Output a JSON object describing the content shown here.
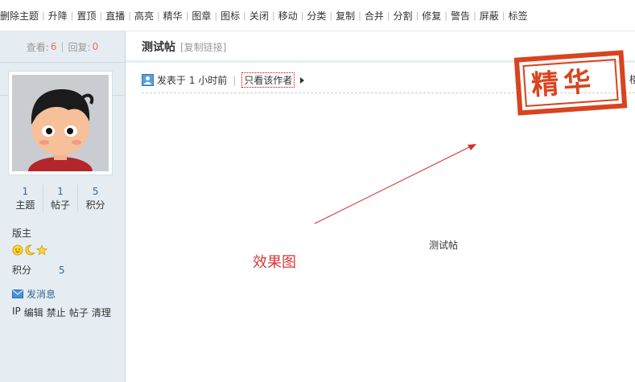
{
  "toolbar": {
    "items": [
      "删除主题",
      "升降",
      "置顶",
      "直播",
      "高亮",
      "精华",
      "图章",
      "图标",
      "关闭",
      "移动",
      "分类",
      "复制",
      "合并",
      "分割",
      "修复",
      "警告",
      "屏蔽",
      "标签"
    ]
  },
  "sidebar": {
    "views_label": "查看:",
    "views": "6",
    "replies_label": "回复:",
    "replies": "0",
    "author": "版主",
    "counters": [
      {
        "value": "1",
        "label": "主题"
      },
      {
        "value": "1",
        "label": "帖子"
      },
      {
        "value": "5",
        "label": "积分"
      }
    ],
    "group": "版主",
    "points_label": "积分",
    "points_value": "5",
    "send_message": "发消息",
    "admin_links": [
      "IP",
      "编辑",
      "禁止",
      "帖子",
      "清理"
    ]
  },
  "post": {
    "title": "测试帖",
    "copy_link": "[复制链接]",
    "posted_time": "发表于 1 小时前",
    "only_author": "只看该作者",
    "stamp": "精华",
    "edge_text": "楼",
    "body": "测试帖",
    "annotation": "效果图"
  },
  "colors": {
    "accent_red": "#d9431e",
    "link_blue": "#336699",
    "count_orange": "#f26c4f",
    "sidebar_bg": "#e5edf2"
  }
}
